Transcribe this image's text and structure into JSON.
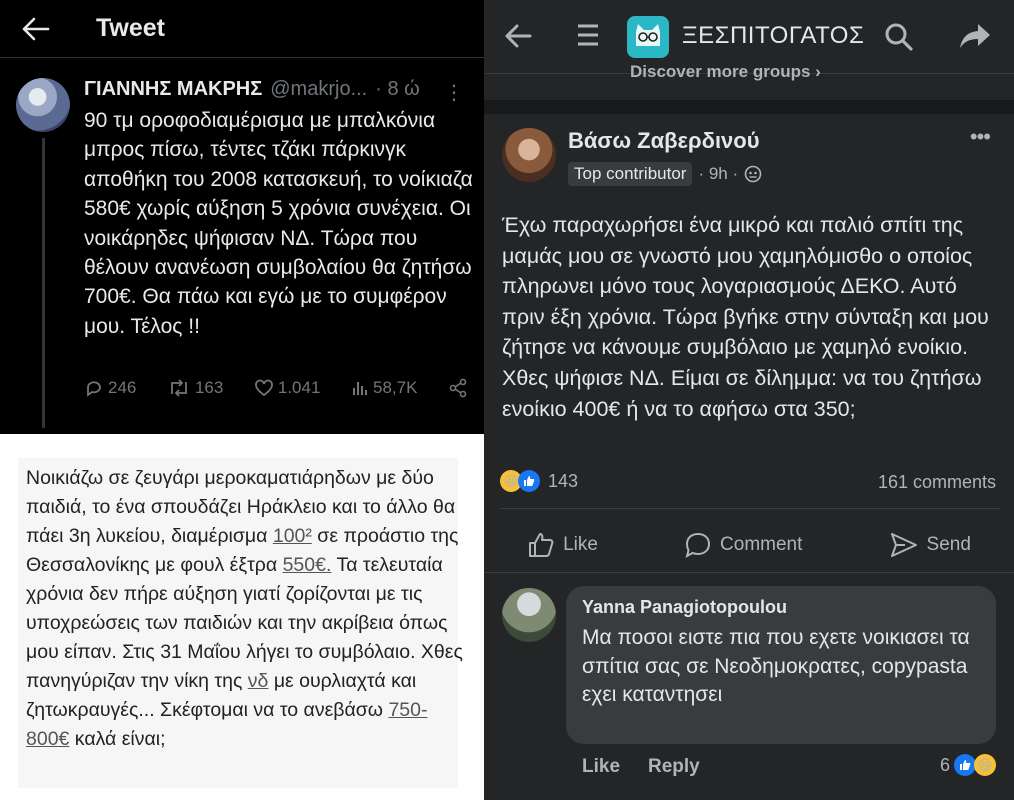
{
  "twitter": {
    "header": {
      "title": "Tweet"
    },
    "tweet": {
      "name": "ΓΙΑΝΝΗΣ ΜΑΚΡΗΣ",
      "handle": "@makrjo...",
      "time": "· 8 ώ",
      "text": "90 τμ οροφοδιαμέρισμα με μπαλκόνια μπρος πίσω, τέντες τζάκι πάρκινγκ αποθήκη του 2008 κατασκευή, το νοίκιαζα 580€ χωρίς αύξηση 5 χρόνια συνέχεια. Οι νοικάρηδες ψήφισαν ΝΔ. Τώρα που θέλουν ανανέωση συμβολαίου θα ζητήσω 700€. Θα πάω και εγώ με το συμφέρον μου. Τέλος !!",
      "replies": "246",
      "retweets": "163",
      "likes": "1.041",
      "views": "58,7K"
    }
  },
  "note": {
    "text_before": "Νοικιάζω σε ζευγάρι μεροκαματιάρηδων με δύο παιδιά, το ένα σπουδάζει Ηράκλειο και το άλλο θα πάει 3η λυκείου, διαμέρισμα ",
    "area": "100²",
    "text_mid1": " σε προάστιο της Θεσσαλονίκης με φουλ έξτρα ",
    "rent": "550€.",
    "text_mid2": " Τα τελευταία χρόνια δεν πήρε αύξηση γιατί ζορίζονται με τις υποχρεώσεις των παιδιών και την ακρίβεια όπως μου είπαν. Στις 31 Μαΐου λήγει το συμβόλαιο. Χθες πανηγύριζαν την νίκη της ",
    "party": "νδ",
    "text_mid3": " με ουρλιαχτά και ζητωκραυγές... Σκέφτομαι να το ανεβάσω ",
    "new_rent": "750-800€",
    "text_end": " καλά είναι;"
  },
  "facebook": {
    "group_name": "ΞΕΣΠΙΤΟΓΑΤΟΣ",
    "discover": "Discover more groups ›",
    "post": {
      "author": "Βάσω Ζαβερδινού",
      "badge": "Top contributor",
      "time": "· 9h ·",
      "text": "Έχω παραχωρήσει ένα μικρό και παλιό σπίτι της μαμάς μου σε γνωστό μου χαμηλόμισθο ο οποίος πληρωνει μόνο τους λογαριασμούς ΔΕΚΟ. Αυτό πριν έξη χρόνια.  Τώρα βγήκε στην σύνταξη και μου ζήτησε να κάνουμε συμβόλαιο με χαμηλό ενοίκιο.  Χθες ψήφισε ΝΔ. Είμαι σε δίλημμα: να του ζητήσω ενοίκιο 400€ ή να το αφήσω στα 350;",
      "reactions": "143",
      "comments": "161 comments",
      "like_label": "Like",
      "comment_label": "Comment",
      "send_label": "Send"
    },
    "comment": {
      "author": "Yanna Panagiotopoulou",
      "text": "Μα ποσοι ειστε πια που εχετε νοικιασει τα σπίτια σας σε Νεοδημοκρατες, copypasta εχει καταντησει",
      "like": "Like",
      "reply": "Reply",
      "reactions": "6"
    }
  }
}
